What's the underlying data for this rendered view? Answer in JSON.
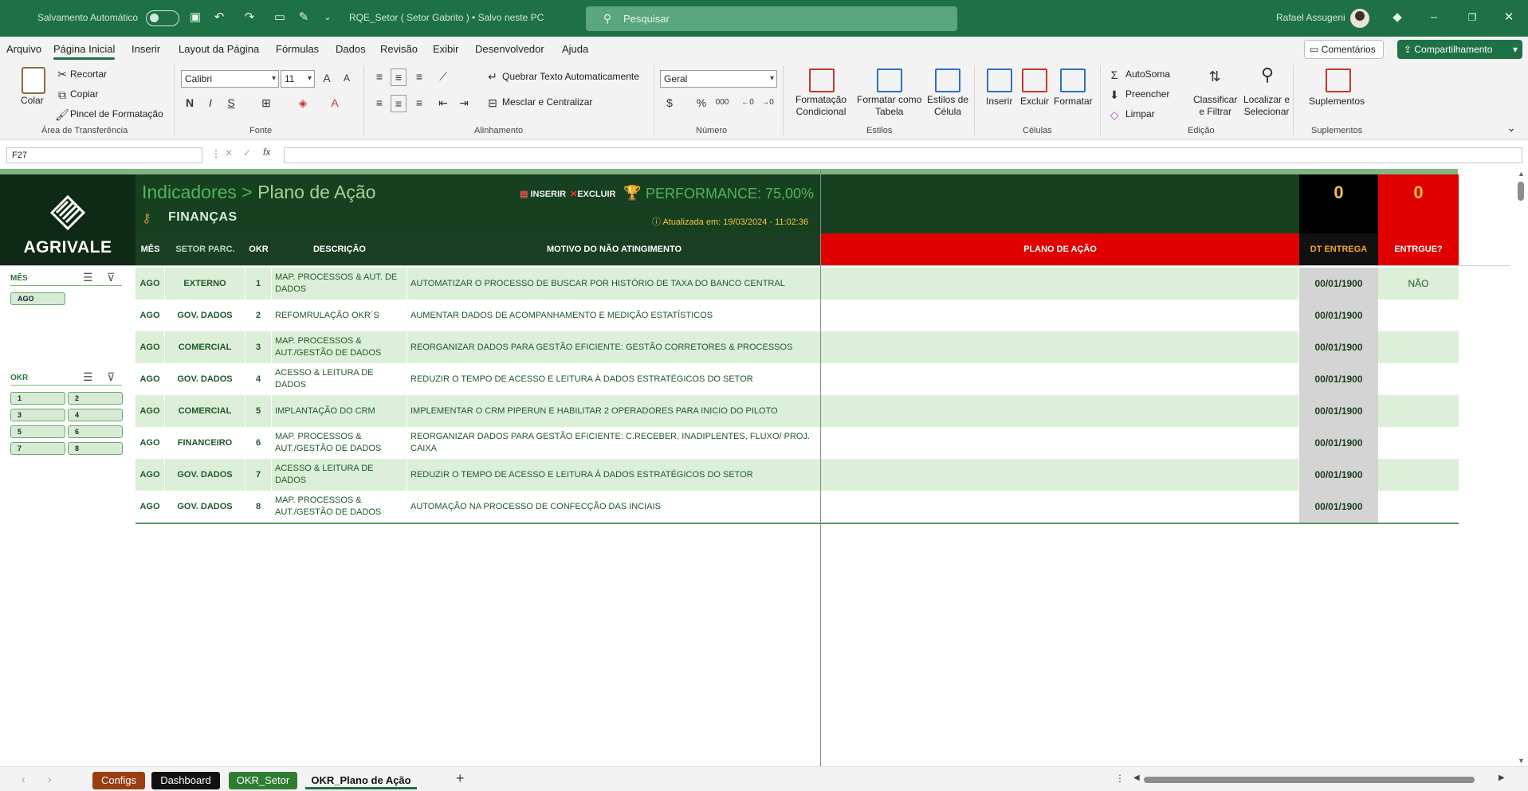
{
  "titlebar": {
    "autosave_label": "Salvamento Automático",
    "document": "RQE_Setor ( Setor Gabrito ) • Salvo neste PC",
    "search_placeholder": "Pesquisar",
    "user": "Rafael Assugeni"
  },
  "menu": {
    "items": [
      "Arquivo",
      "Página Inicial",
      "Inserir",
      "Layout da Página",
      "Fórmulas",
      "Dados",
      "Revisão",
      "Exibir",
      "Desenvolvedor",
      "Ajuda"
    ],
    "comments": "Comentários",
    "share": "Compartilhamento"
  },
  "ribbon": {
    "clipboard": {
      "paste": "Colar",
      "cut": "Recortar",
      "copy": "Copiar",
      "painter": "Pincel de Formatação",
      "group": "Área de Transferência"
    },
    "font": {
      "name": "Calibri",
      "size": "11",
      "bold": "N",
      "italic": "I",
      "underline": "S",
      "group": "Fonte"
    },
    "alignment": {
      "wrap": "Quebrar Texto Automaticamente",
      "merge": "Mesclar e Centralizar",
      "group": "Alinhamento"
    },
    "number": {
      "format": "Geral",
      "group": "Número"
    },
    "styles": {
      "conditional": "Formatação\nCondicional",
      "table": "Formatar como\nTabela",
      "cell": "Estilos de\nCélula",
      "group": "Estilos"
    },
    "cells": {
      "insert": "Inserir",
      "delete": "Excluir",
      "format": "Formatar",
      "group": "Células"
    },
    "editing": {
      "autosum": "AutoSoma",
      "fill": "Preencher",
      "clear": "Limpar",
      "sort": "Classificar\ne Filtrar",
      "find": "Localizar e\nSelecionar",
      "group": "Edição"
    },
    "addins": {
      "label": "Suplementos",
      "group": "Suplementos"
    }
  },
  "formula_bar": {
    "cell_ref": "F27",
    "fx": "fx",
    "content": ""
  },
  "dashboard": {
    "logo": "AGRIVALE",
    "title_prefix": "Indicadores > ",
    "title_main": "Plano de Ação",
    "sector": "FINANÇAS",
    "insert_label": "INSERIR",
    "delete_label": "EXCLUIR",
    "performance": "PERFORMANCE: 75,00%",
    "updated": "Atualizada em: 19/03/2024 - 11:02:36",
    "count_black": "0",
    "count_red": "0",
    "headers": {
      "mes": "MÊS",
      "setor": "SETOR PARC.",
      "okr": "OKR",
      "descricao": "DESCRIÇÃO",
      "motivo": "MOTIVO DO NÃO ATINGIMENTO",
      "plano": "PLANO DE AÇÃO",
      "dt": "DT ENTREGA",
      "entregue": "ENTRGUE?"
    },
    "rows": [
      {
        "mes": "AGO",
        "setor": "EXTERNO",
        "okr": "1",
        "descricao": "MAP. PROCESSOS & AUT. DE DADOS",
        "motivo": "AUTOMATIZAR O PROCESSO DE BUSCAR POR HISTÓRIO DE TAXA DO BANCO CENTRAL",
        "plano": "",
        "dt": "00/01/1900",
        "entregue": "NÃO"
      },
      {
        "mes": "AGO",
        "setor": "GOV. DADOS",
        "okr": "2",
        "descricao": "REFOMRULAÇÃO OKR´S",
        "motivo": "AUMENTAR DADOS DE ACOMPANHAMENTO E MEDIÇÃO ESTATÍSTICOS",
        "plano": "",
        "dt": "00/01/1900",
        "entregue": ""
      },
      {
        "mes": "AGO",
        "setor": "COMERCIAL",
        "okr": "3",
        "descricao": "MAP. PROCESSOS & AUT./GESTÃO DE DADOS",
        "motivo": "REORGANIZAR DADOS PARA GESTÃO EFICIENTE: GESTÃO CORRETORES & PROCESSOS",
        "plano": "",
        "dt": "00/01/1900",
        "entregue": ""
      },
      {
        "mes": "AGO",
        "setor": "GOV. DADOS",
        "okr": "4",
        "descricao": "ACESSO & LEITURA DE DADOS",
        "motivo": "REDUZIR O TEMPO DE ACESSO E LEITURA À DADOS ESTRATÉGICOS DO SETOR",
        "plano": "",
        "dt": "00/01/1900",
        "entregue": ""
      },
      {
        "mes": "AGO",
        "setor": "COMERCIAL",
        "okr": "5",
        "descricao": "IMPLANTAÇÃO DO CRM",
        "motivo": "IMPLEMENTAR O CRM PIPERUN E HABILITAR 2 OPERADORES PARA INICIO DO PILOTO",
        "plano": "",
        "dt": "00/01/1900",
        "entregue": ""
      },
      {
        "mes": "AGO",
        "setor": "FINANCEIRO",
        "okr": "6",
        "descricao": "MAP. PROCESSOS & AUT./GESTÃO DE DADOS",
        "motivo": "REORGANIZAR DADOS PARA GESTÃO EFICIENTE: C.RECEBER, INADIPLENTES, FLUXO/ PROJ. CAIXA",
        "plano": "",
        "dt": "00/01/1900",
        "entregue": ""
      },
      {
        "mes": "AGO",
        "setor": "GOV. DADOS",
        "okr": "7",
        "descricao": "ACESSO & LEITURA DE DADOS",
        "motivo": "REDUZIR O TEMPO DE ACESSO E LEITURA À DADOS ESTRATÉGICOS DO SETOR",
        "plano": "",
        "dt": "00/01/1900",
        "entregue": ""
      },
      {
        "mes": "AGO",
        "setor": "GOV. DADOS",
        "okr": "8",
        "descricao": "MAP. PROCESSOS & AUT./GESTÃO DE DADOS",
        "motivo": "AUTOMAÇÃO NA PROCESSO DE CONFECÇÃO DAS INCIAIS",
        "plano": "",
        "dt": "00/01/1900",
        "entregue": ""
      }
    ]
  },
  "slicers": {
    "mes": {
      "title": "MÊS",
      "items": [
        "AGO"
      ]
    },
    "okr": {
      "title": "OKR",
      "items": [
        "1",
        "2",
        "3",
        "4",
        "5",
        "6",
        "7",
        "8"
      ]
    }
  },
  "sheet_tabs": [
    {
      "label": "Configs",
      "color": "#9a3e12"
    },
    {
      "label": "Dashboard",
      "color": "#111111"
    },
    {
      "label": "OKR_Setor",
      "color": "#2e7d32"
    },
    {
      "label": "OKR_Plano de Ação",
      "color": "",
      "active": true
    }
  ],
  "colors": {
    "excel_green": "#1e7145",
    "banner": "#16401f",
    "row_alt": "#dcefd8",
    "accent_red": "#e00000",
    "gold": "#f5c242"
  }
}
